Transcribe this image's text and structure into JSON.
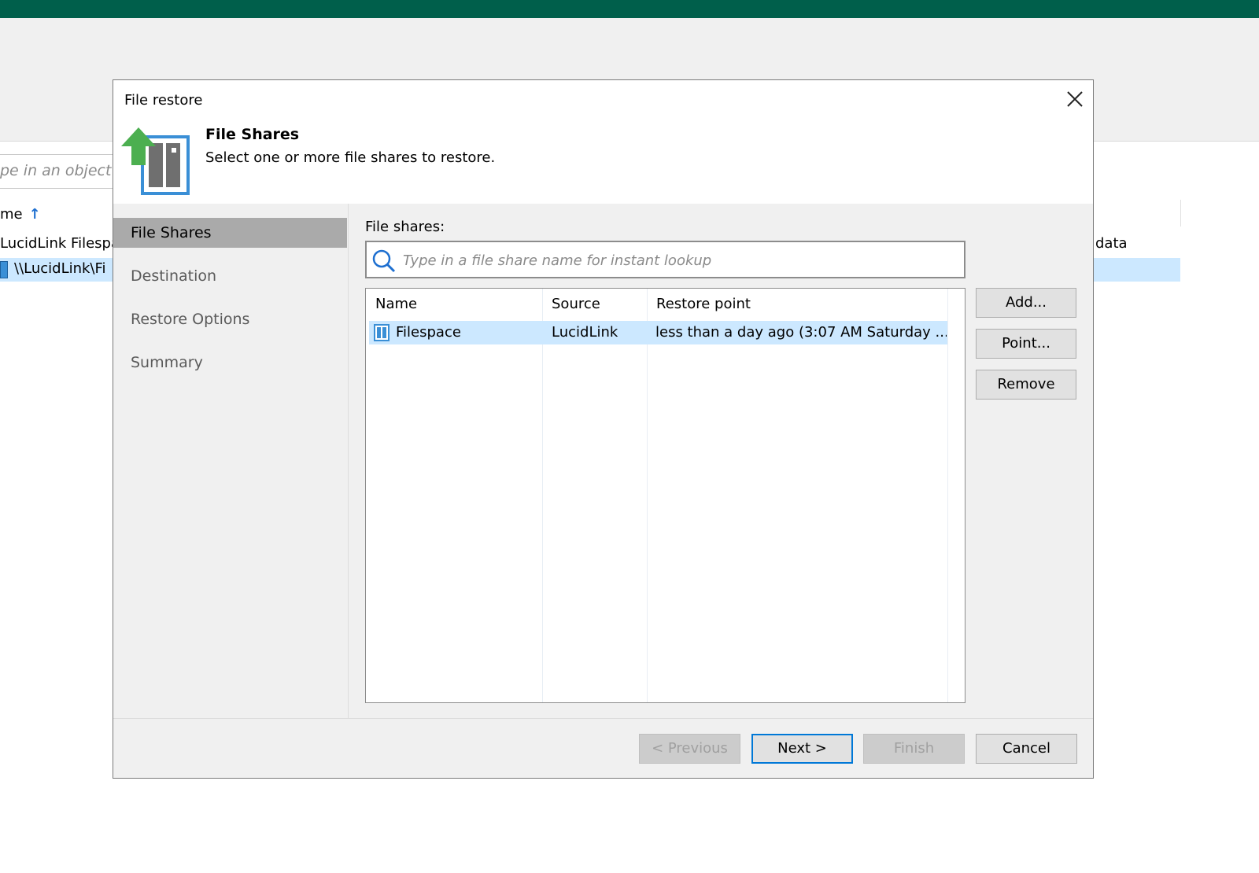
{
  "background": {
    "search_placeholder": "pe in an object na",
    "column_name": "me",
    "group_label": "LucidLink Filespa",
    "row_label": "\\\\LucidLink\\Fi",
    "right_column_text": "data"
  },
  "dialog": {
    "title": "File restore",
    "step_title": "File Shares",
    "step_description": "Select one or more file shares to restore.",
    "nav": [
      {
        "label": "File Shares",
        "active": true
      },
      {
        "label": "Destination",
        "active": false
      },
      {
        "label": "Restore Options",
        "active": false
      },
      {
        "label": "Summary",
        "active": false
      }
    ],
    "file_shares_label": "File shares:",
    "search_placeholder": "Type in a file share name for instant lookup",
    "table": {
      "columns": [
        "Name",
        "Source",
        "Restore point"
      ],
      "rows": [
        {
          "name": "Filespace",
          "source": "LucidLink",
          "restore_point": "less than a day ago (3:07 AM Saturday ..."
        }
      ]
    },
    "side_buttons": {
      "add": "Add...",
      "point": "Point...",
      "remove": "Remove"
    },
    "footer_buttons": {
      "previous": "< Previous",
      "next": "Next >",
      "finish": "Finish",
      "cancel": "Cancel"
    }
  },
  "colors": {
    "top_bar": "#005f4b",
    "selection": "#cce8ff",
    "nav_active": "#aaaaaa",
    "primary_border": "#0078d7",
    "icon_green": "#4caf50",
    "icon_blue": "#3a8fd6"
  },
  "icons": [
    "close-icon",
    "file-share-restore-icon",
    "search-icon",
    "file-share-icon"
  ]
}
